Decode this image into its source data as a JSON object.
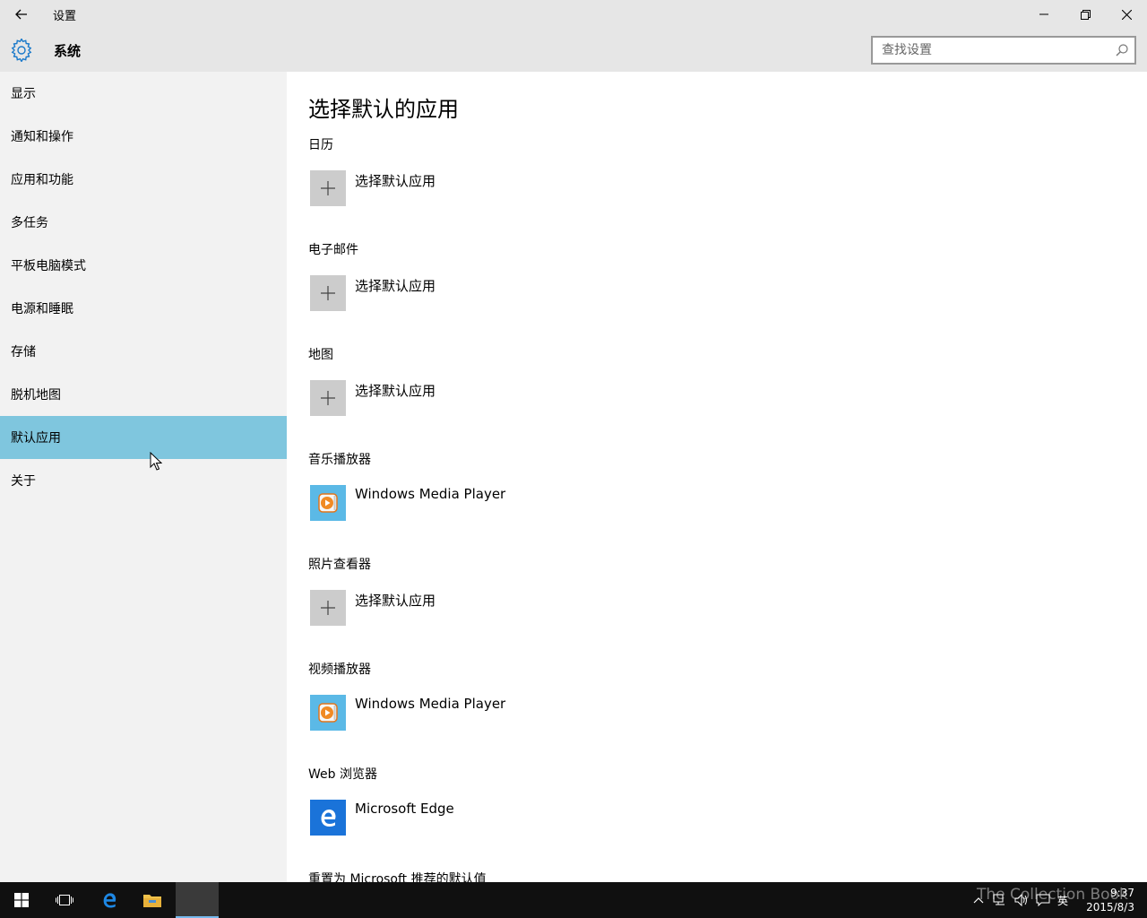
{
  "window": {
    "title": "设置",
    "section": "系统"
  },
  "search": {
    "placeholder": "查找设置"
  },
  "sidebar": {
    "items": [
      {
        "label": "显示"
      },
      {
        "label": "通知和操作"
      },
      {
        "label": "应用和功能"
      },
      {
        "label": "多任务"
      },
      {
        "label": "平板电脑模式"
      },
      {
        "label": "电源和睡眠"
      },
      {
        "label": "存储"
      },
      {
        "label": "脱机地图"
      },
      {
        "label": "默认应用",
        "active": true
      },
      {
        "label": "关于"
      }
    ]
  },
  "main": {
    "title": "选择默认的应用",
    "categories": [
      {
        "label": "日历",
        "app": "选择默认应用",
        "icon": "plus-icon"
      },
      {
        "label": "电子邮件",
        "app": "选择默认应用",
        "icon": "plus-icon"
      },
      {
        "label": "地图",
        "app": "选择默认应用",
        "icon": "plus-icon"
      },
      {
        "label": "音乐播放器",
        "app": "Windows Media Player",
        "icon": "windows-media-player-icon"
      },
      {
        "label": "照片查看器",
        "app": "选择默认应用",
        "icon": "plus-icon"
      },
      {
        "label": "视频播放器",
        "app": "Windows Media Player",
        "icon": "windows-media-player-icon"
      },
      {
        "label": "Web 浏览器",
        "app": "Microsoft Edge",
        "icon": "edge-icon"
      }
    ],
    "reset_label": "重置为 Microsoft 推荐的默认值"
  },
  "taskbar": {
    "time": "9:37",
    "date": "2015/8/3",
    "ime": "英",
    "watermark": "The Collection Book"
  },
  "colors": {
    "chrome": "#e6e6e6",
    "sidebar": "#f2f2f2",
    "selected": "#7fc6de",
    "tile_gray": "#cccccc",
    "edge_blue": "#1a73d9",
    "taskbar": "#101010"
  }
}
